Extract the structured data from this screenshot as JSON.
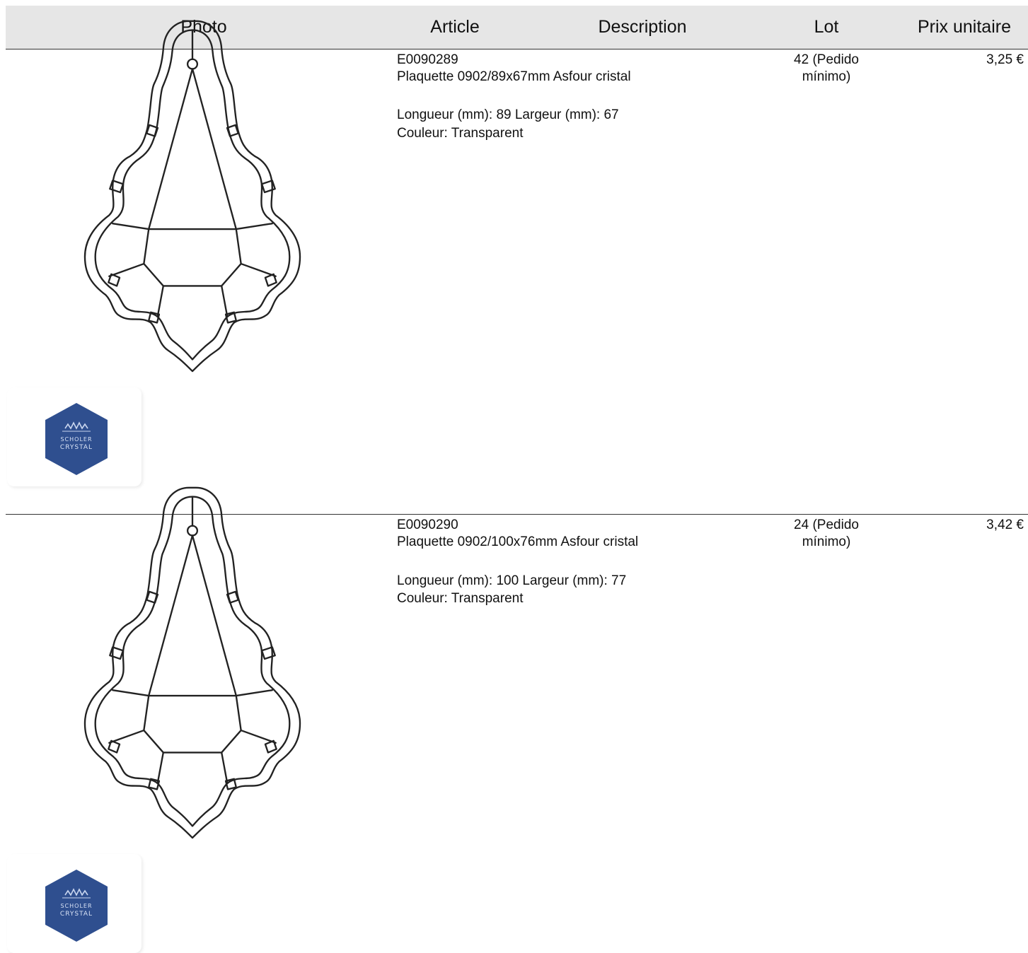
{
  "table": {
    "headers": {
      "photo": "Photo",
      "article": "Article",
      "description": "Description",
      "lot": "Lot",
      "price": "Prix unitaire"
    },
    "rows": [
      {
        "code": "E0090289",
        "name": "Plaquette 0902/89x67mm Asfour cristal",
        "dimensions": "Longueur (mm): 89 Largeur (mm): 67",
        "color": "Couleur: Transparent",
        "lot_line1": "42 (Pedido",
        "lot_line2": "mínimo)",
        "price": "3,25 €",
        "logo_text_1": "SCHOLER",
        "logo_text_2": "CRYSTAL"
      },
      {
        "code": "E0090290",
        "name": "Plaquette 0902/100x76mm Asfour cristal",
        "dimensions": "Longueur (mm): 100 Largeur (mm): 77",
        "color": "Couleur: Transparent",
        "lot_line1": "24 (Pedido",
        "lot_line2": "mínimo)",
        "price": "3,42 €",
        "logo_text_1": "SCHOLER",
        "logo_text_2": "CRYSTAL"
      }
    ]
  },
  "colors": {
    "header_bg": "#e6e6e6",
    "logo_blue": "#2f4f8f",
    "line": "#333333"
  },
  "icons": {
    "product_drawing": "crystal-pendant-drawing",
    "brand_logo": "hexagon-brand-logo"
  }
}
